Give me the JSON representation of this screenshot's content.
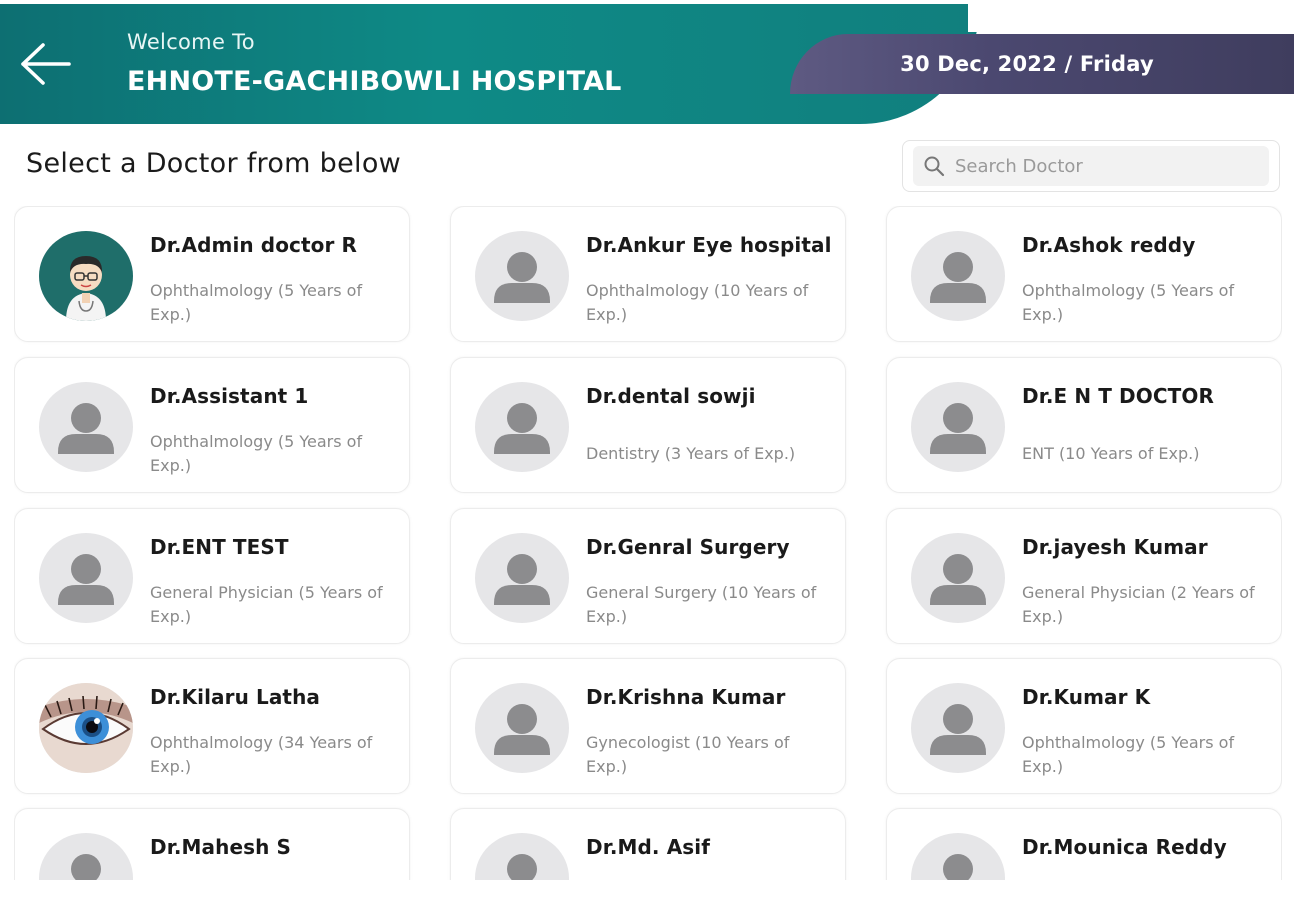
{
  "header": {
    "welcome": "Welcome To",
    "hospital": "EHNOTE-GACHIBOWLI HOSPITAL",
    "date": "30 Dec, 2022 / Friday",
    "back_icon": "arrow-left-icon",
    "colors": {
      "primary": "#0e8a86",
      "date_bar": "#4b4870"
    }
  },
  "page_title": "Select a Doctor from below",
  "search": {
    "placeholder": "Search Doctor",
    "value": "",
    "icon": "search-icon"
  },
  "doctors": [
    {
      "name": "Dr.Admin doctor R",
      "spec": "Ophthalmology (5 Years of Exp.)",
      "avatar": "cartoon-doctor"
    },
    {
      "name": "Dr.Ankur Eye hospital",
      "spec": "Ophthalmology (10 Years of Exp.)",
      "avatar": "placeholder"
    },
    {
      "name": "Dr.Ashok reddy",
      "spec": "Ophthalmology (5 Years of Exp.)",
      "avatar": "placeholder"
    },
    {
      "name": "Dr.Assistant 1",
      "spec": "Ophthalmology (5 Years of Exp.)",
      "avatar": "placeholder"
    },
    {
      "name": "Dr.dental sowji",
      "spec": "Dentistry (3 Years of Exp.)",
      "avatar": "placeholder"
    },
    {
      "name": "Dr.E N T DOCTOR",
      "spec": "ENT (10 Years of Exp.)",
      "avatar": "placeholder"
    },
    {
      "name": "Dr.ENT TEST",
      "spec": "General Physician (5 Years of Exp.)",
      "avatar": "placeholder"
    },
    {
      "name": "Dr.Genral Surgery",
      "spec": "General Surgery (10 Years of Exp.)",
      "avatar": "placeholder"
    },
    {
      "name": "Dr.jayesh Kumar",
      "spec": "General Physician (2 Years of Exp.)",
      "avatar": "placeholder"
    },
    {
      "name": "Dr.Kilaru Latha",
      "spec": "Ophthalmology (34 Years of Exp.)",
      "avatar": "eye"
    },
    {
      "name": "Dr.Krishna Kumar",
      "spec": "Gynecologist (10 Years of Exp.)",
      "avatar": "placeholder"
    },
    {
      "name": "Dr.Kumar K",
      "spec": "Ophthalmology (5 Years of Exp.)",
      "avatar": "placeholder"
    },
    {
      "name": "Dr.Mahesh S",
      "spec": "",
      "avatar": "placeholder"
    },
    {
      "name": "Dr.Md. Asif",
      "spec": "",
      "avatar": "placeholder"
    },
    {
      "name": "Dr.Mounica Reddy",
      "spec": "",
      "avatar": "placeholder"
    }
  ]
}
